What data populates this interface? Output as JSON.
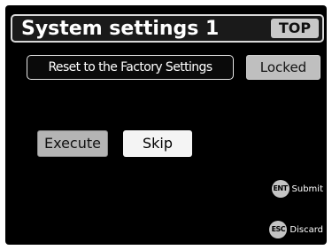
{
  "header": {
    "title": "System settings 1",
    "top_label": "TOP"
  },
  "actions": {
    "reset_label": "Reset to the Factory Settings",
    "locked_label": "Locked",
    "execute_label": "Execute",
    "skip_label": "Skip"
  },
  "hints": {
    "ent_key": "ENT",
    "ent_label": "Submit",
    "esc_key": "ESC",
    "esc_label": "Discard"
  },
  "colors": {
    "background": "#000000",
    "button_gray": "#b4b4b4",
    "selected_button": "#f4f4f4"
  }
}
